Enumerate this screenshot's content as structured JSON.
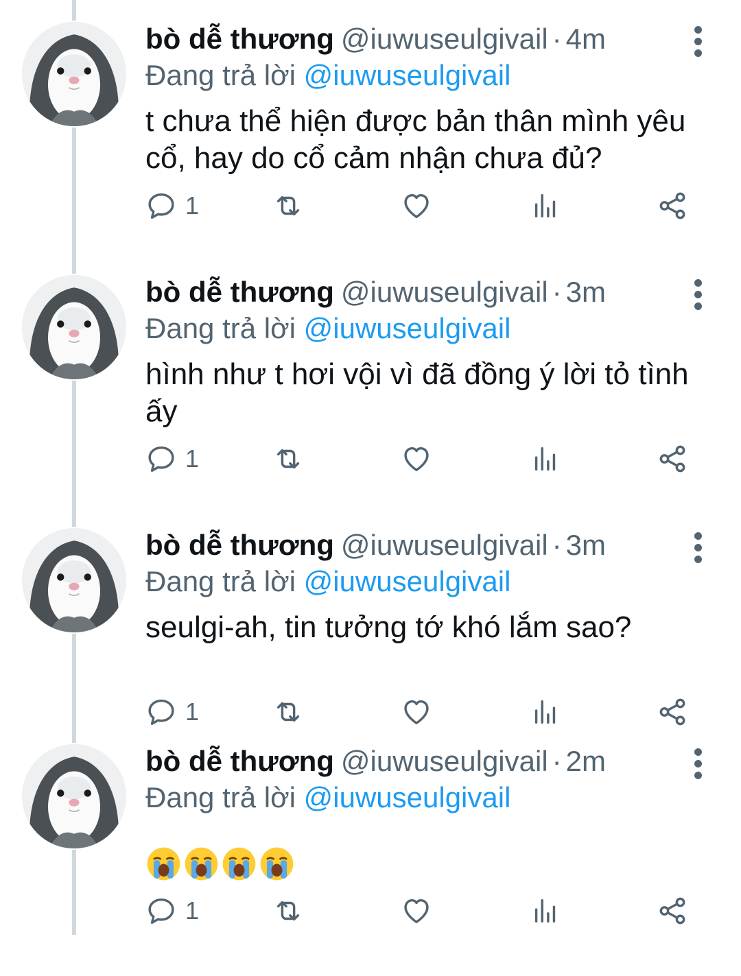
{
  "colors": {
    "name_text": "#0f1419",
    "secondary_text": "#536471",
    "mention": "#1d9bf0",
    "thread_line": "#cfd9de"
  },
  "icons": [
    "more-vertical-icon",
    "reply-icon",
    "retweet-icon",
    "like-icon",
    "analytics-icon",
    "share-icon"
  ],
  "tweets": [
    {
      "name": "bò dễ thương",
      "handle": "@iuwuseulgivail",
      "separator": "·",
      "time": "4m",
      "reply_prefix": "Đang trả lời",
      "reply_to": "@iuwuseulgivail",
      "text": "t chưa thể hiện được bản thân mình yêu cổ, hay do cổ cảm nhận chưa đủ?",
      "reply_count": "1"
    },
    {
      "name": "bò dễ thương",
      "handle": "@iuwuseulgivail",
      "separator": "·",
      "time": "3m",
      "reply_prefix": "Đang trả lời",
      "reply_to": "@iuwuseulgivail",
      "text": "hình như t hơi vội vì đã đồng ý lời tỏ tình ấy",
      "reply_count": "1"
    },
    {
      "name": "bò dễ thương",
      "handle": "@iuwuseulgivail",
      "separator": "·",
      "time": "3m",
      "reply_prefix": "Đang trả lời",
      "reply_to": "@iuwuseulgivail",
      "text": "seulgi-ah, tin tưởng tớ khó lắm sao?",
      "reply_count": "1"
    },
    {
      "name": "bò dễ thương",
      "handle": "@iuwuseulgivail",
      "separator": "·",
      "time": "2m",
      "reply_prefix": "Đang trả lời",
      "reply_to": "@iuwuseulgivail",
      "text": "😭😭😭😭",
      "reply_count": "1"
    }
  ]
}
